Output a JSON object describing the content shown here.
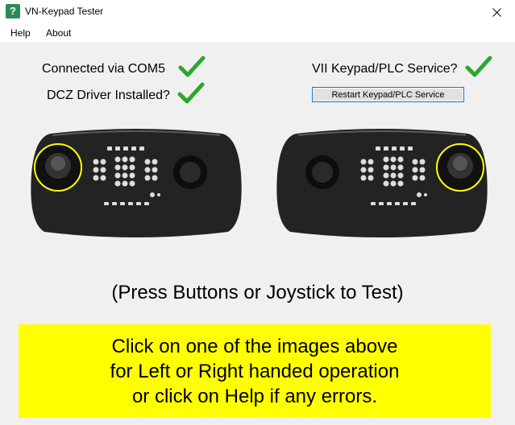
{
  "window": {
    "title": "VN-Keypad Tester",
    "icon": "question-icon"
  },
  "menu": {
    "items": [
      "Help",
      "About"
    ]
  },
  "status": {
    "connected": "Connected via COM5",
    "driver": "DCZ Driver Installed?",
    "service": "VII Keypad/PLC Service?",
    "check_color": "#2aa82a"
  },
  "restart_button": {
    "label": "Restart Keypad/PLC Service"
  },
  "keypads": {
    "left_image": "keypad-left-handed",
    "right_image": "keypad-right-handed",
    "highlight_color": "#ffff00"
  },
  "instructions": {
    "press": "(Press Buttons or Joystick to Test)",
    "lines": [
      "Click on one of the images above",
      "for Left or Right handed operation",
      "or click on Help if any errors."
    ],
    "box_color": "#ffff00"
  }
}
